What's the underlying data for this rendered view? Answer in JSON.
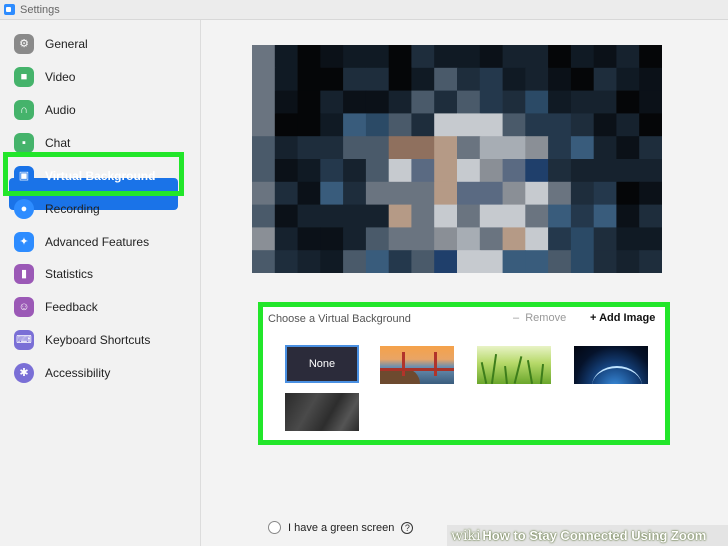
{
  "window": {
    "title": "Settings"
  },
  "sidebar": {
    "items": [
      {
        "label": "General",
        "icon": "gear-icon",
        "color": "#8a8a8a"
      },
      {
        "label": "Video",
        "icon": "video-camera-icon",
        "color": "#45b36b"
      },
      {
        "label": "Audio",
        "icon": "headphones-icon",
        "color": "#45b36b"
      },
      {
        "label": "Chat",
        "icon": "chat-bubble-icon",
        "color": "#45b36b"
      },
      {
        "label": "Virtual Background",
        "icon": "person-card-icon",
        "color": "#1a73e8",
        "active": true
      },
      {
        "label": "Recording",
        "icon": "record-icon",
        "color": "#2d8cff"
      },
      {
        "label": "Advanced Features",
        "icon": "sparkles-icon",
        "color": "#2d8cff"
      },
      {
        "label": "Statistics",
        "icon": "bar-chart-icon",
        "color": "#9b59b6"
      },
      {
        "label": "Feedback",
        "icon": "smiley-icon",
        "color": "#9b59b6"
      },
      {
        "label": "Keyboard Shortcuts",
        "icon": "keyboard-icon",
        "color": "#7a6fd6"
      },
      {
        "label": "Accessibility",
        "icon": "accessibility-icon",
        "color": "#7a6fd6"
      }
    ]
  },
  "chooser": {
    "title": "Choose a Virtual Background",
    "remove_label": "Remove",
    "add_label": "Add Image",
    "none_label": "None"
  },
  "green_screen": {
    "label": "I have a green screen",
    "help": "?"
  },
  "watermark": {
    "wiki": "wiki",
    "text": "How to Stay Connected Using Zoom"
  },
  "colors": {
    "accent": "#1a73e8",
    "highlight": "#22e62a"
  }
}
